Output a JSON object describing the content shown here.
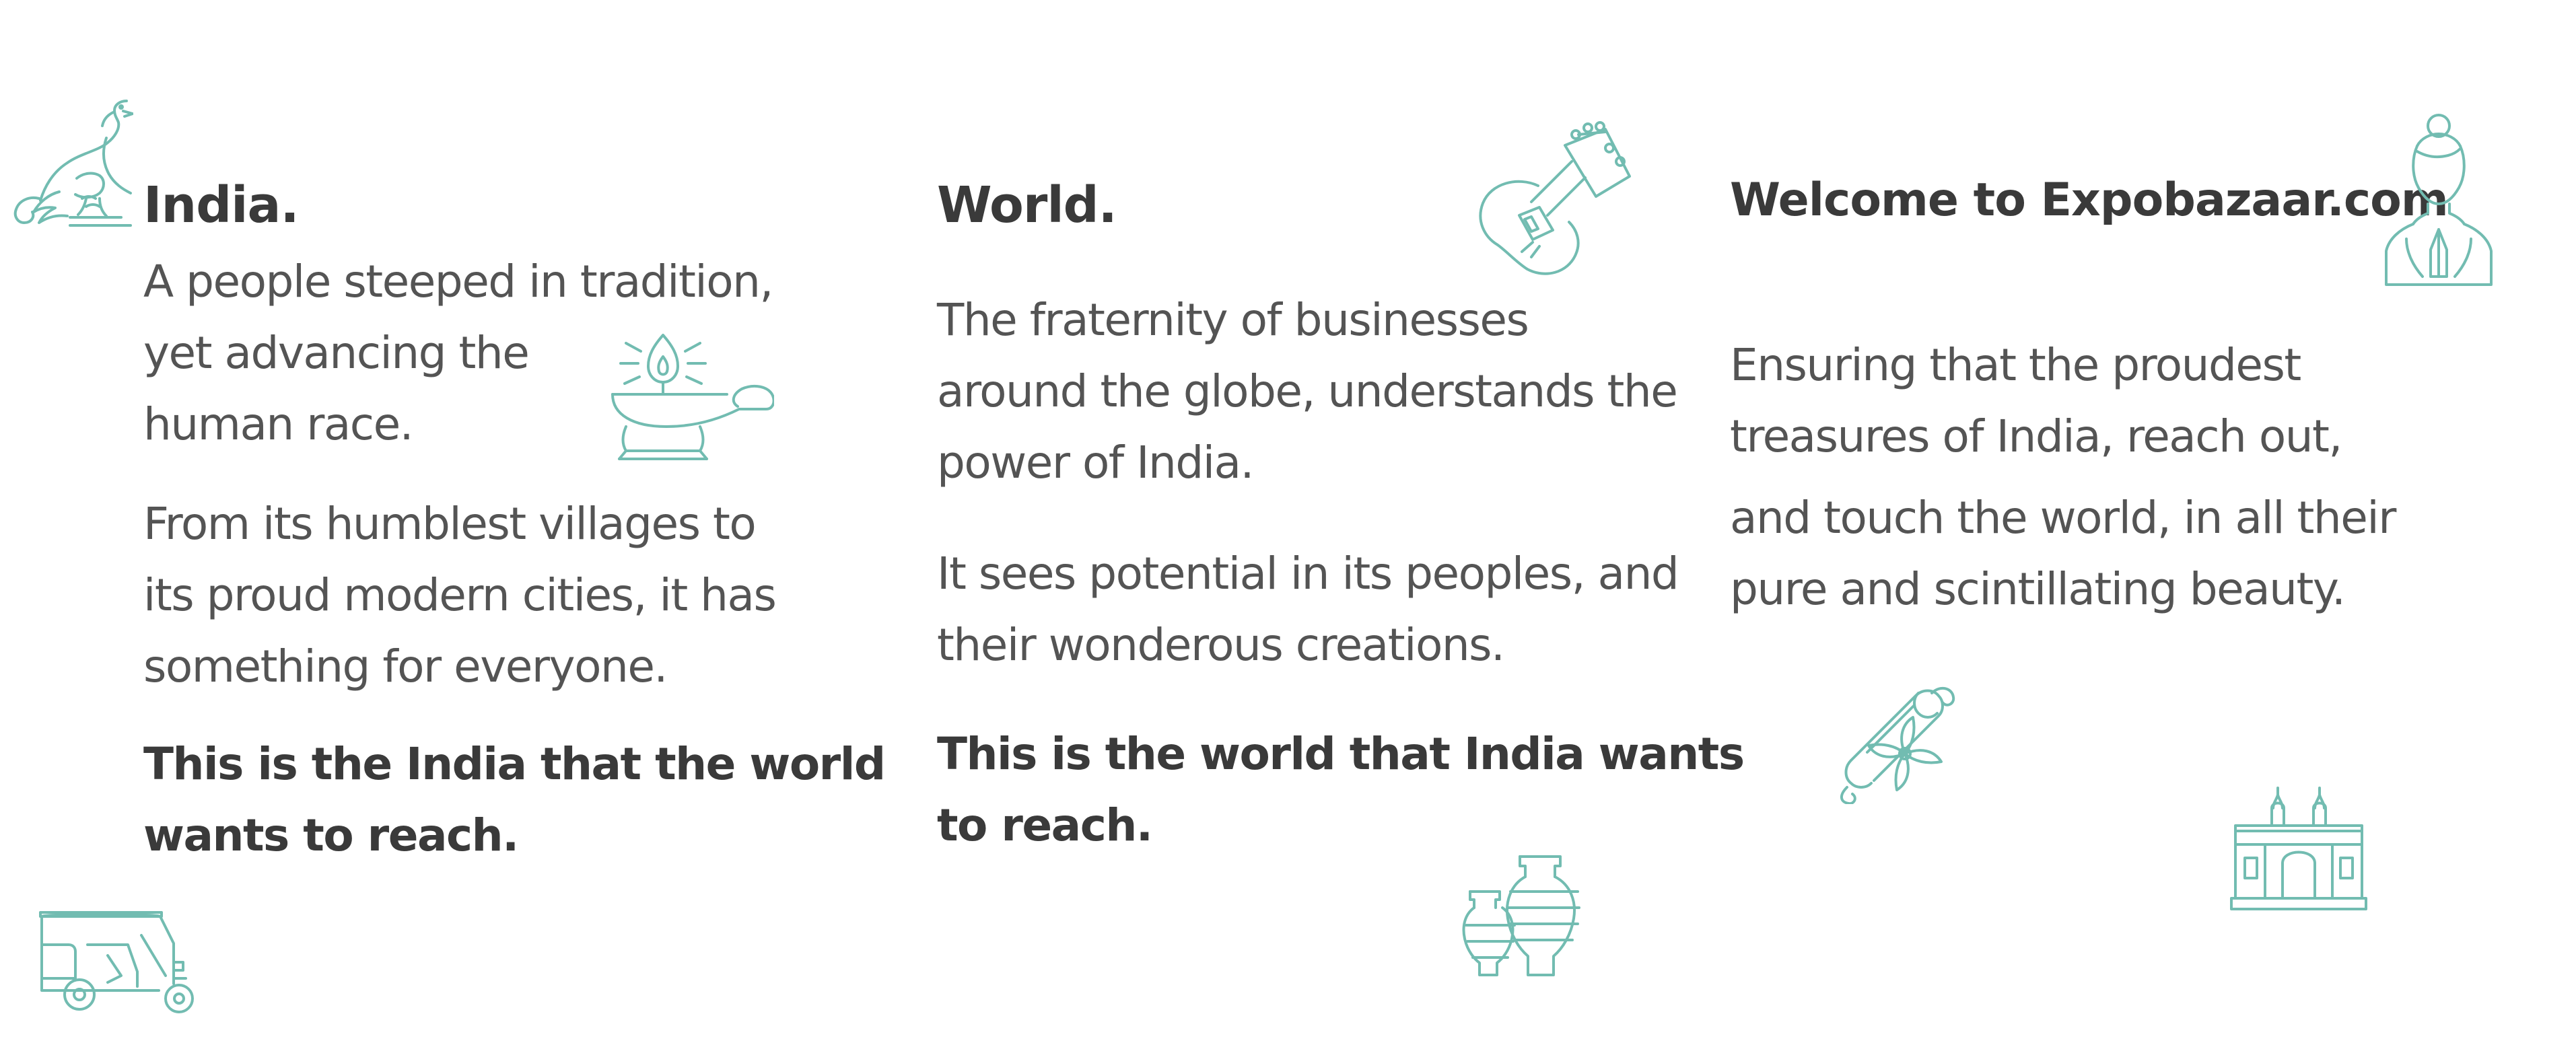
{
  "india": {
    "title": "India.",
    "para1": [
      "A people steeped in tradition,",
      "yet advancing the",
      "human race."
    ],
    "para2": [
      "From its humblest villages to",
      "its proud modern cities, it has",
      "something for everyone."
    ],
    "para3": [
      "This is the India that the world",
      "wants to reach."
    ]
  },
  "world": {
    "title": "World.",
    "para1": [
      "The fraternity of businesses",
      "around the globe, understands the",
      "power of India."
    ],
    "para2": [
      "It sees potential in its peoples, and",
      "their wonderous creations."
    ],
    "para3": [
      "This is the world that India wants",
      "to reach."
    ]
  },
  "welcome": {
    "title": "Welcome to Expobazaar.com",
    "para1": [
      "Ensuring that the proudest",
      "treasures of India, reach out,"
    ],
    "para2": [
      "and touch the world, in all their",
      "pure and scintillating beauty."
    ]
  },
  "icons": {
    "color": "#72bcb1",
    "list": [
      "peacock-icon",
      "diya-lamp-icon",
      "auto-rickshaw-icon",
      "sitar-icon",
      "vases-icon",
      "namaste-woman-icon",
      "scroll-flower-icon",
      "gateway-of-india-icon"
    ]
  },
  "colors": {
    "heading": "#3a3a3a",
    "body": "#545454",
    "background": "#ffffff"
  }
}
